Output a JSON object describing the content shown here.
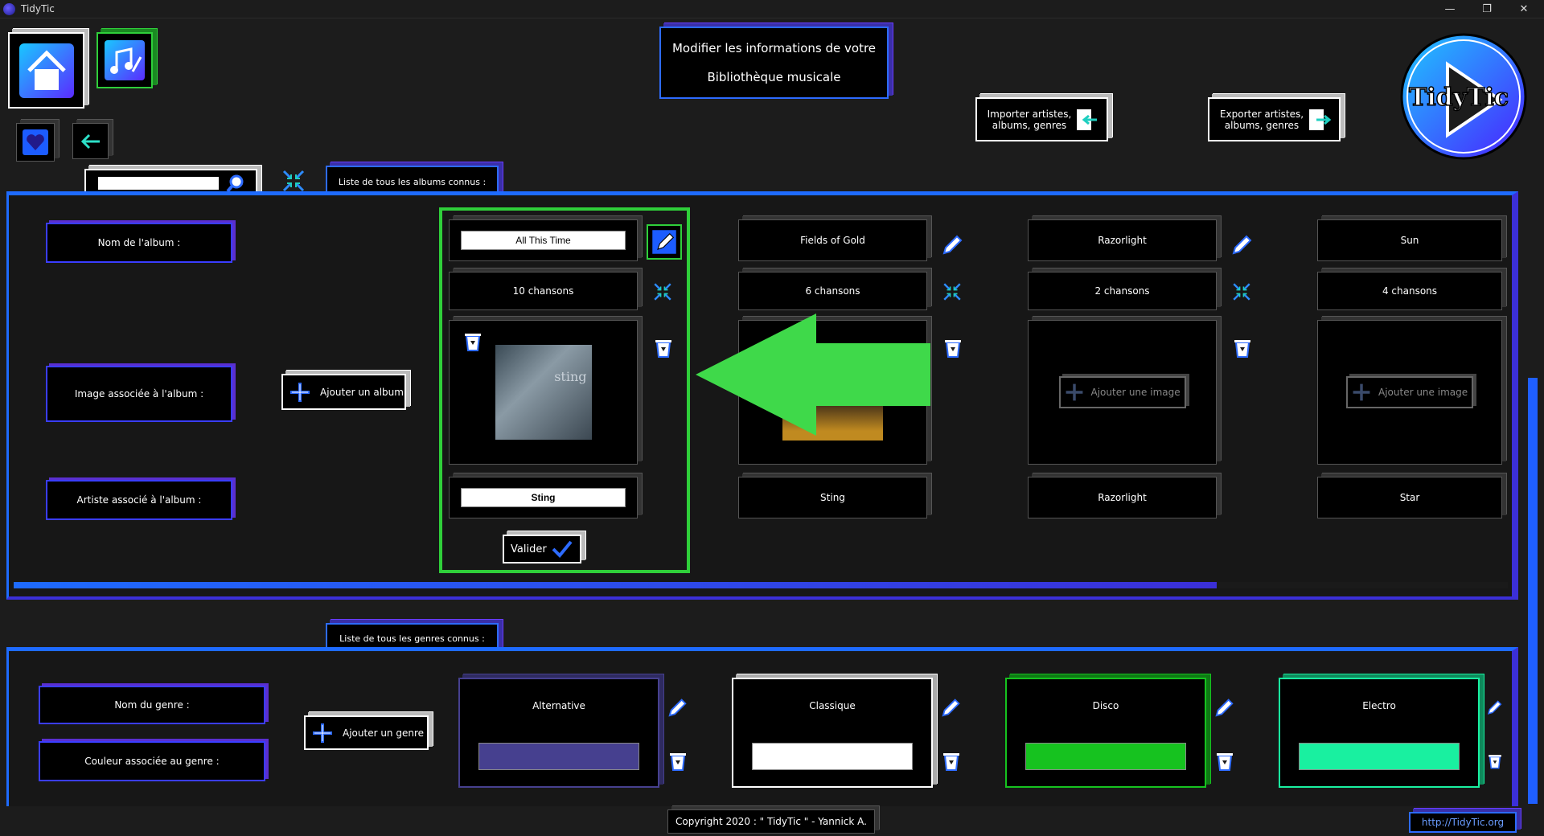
{
  "window": {
    "title": "TidyTic",
    "minimize": "—",
    "restore": "❐",
    "close": "✕"
  },
  "header": {
    "title_line1": "Modifier les informations de votre",
    "title_line2": "Bibliothèque musicale",
    "import_label": "Importer artistes, albums, genres",
    "export_label": "Exporter artistes, albums, genres",
    "logo_text": "TidyTic"
  },
  "search": {
    "value": "",
    "placeholder": ""
  },
  "albums_section": {
    "tab_label": "Liste de tous les albums connus :",
    "row_labels": {
      "name": "Nom de l'album :",
      "image": "Image associée à l'album :",
      "artist": "Artiste associé à l'album :"
    },
    "add_album_label": "Ajouter un album",
    "add_image_label": "Ajouter une image",
    "validate_label": "Valider",
    "albums": [
      {
        "name": "All This Time",
        "songs": "10 chansons",
        "artist": "Sting",
        "editing": true
      },
      {
        "name": "Fields of Gold",
        "songs": "6 chansons",
        "artist": "Sting",
        "editing": false
      },
      {
        "name": "Razorlight",
        "songs": "2 chansons",
        "artist": "Razorlight",
        "editing": false
      },
      {
        "name": "Sun",
        "songs": "4 chansons",
        "artist": "Star",
        "editing": false
      }
    ],
    "album_art_text": "sting",
    "scroll_fraction": 0.805
  },
  "genres_section": {
    "tab_label": "Liste de tous les genres connus :",
    "row_labels": {
      "name": "Nom du genre :",
      "color": "Couleur associée au genre :"
    },
    "add_genre_label": "Ajouter un genre",
    "genres": [
      {
        "name": "Alternative",
        "color": "#46408f"
      },
      {
        "name": "Classique",
        "color": "#ffffff"
      },
      {
        "name": "Disco",
        "color": "#16c21f"
      },
      {
        "name": "Electro",
        "color": "#19f0a0"
      }
    ]
  },
  "footer": {
    "copyright": "Copyright 2020 : \" TidyTic \" - Yannick A.",
    "link": "http://TidyTic.org"
  },
  "colors": {
    "accent_blue": "#1e6bff",
    "accent_purple": "#3b2fd8",
    "highlight_green": "#2fcf3a",
    "arrow_green": "#3fd94a"
  }
}
